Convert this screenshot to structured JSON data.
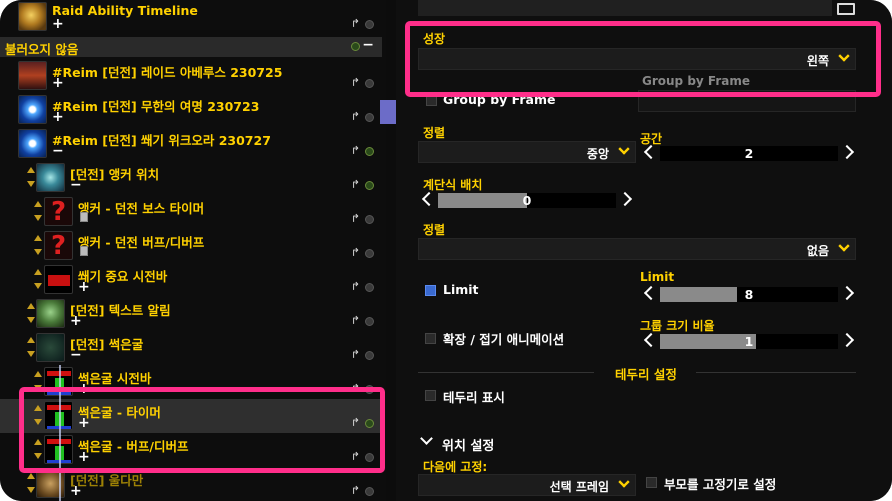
{
  "left_panel": {
    "rows": [
      {
        "title": "Raid Ability Timeline",
        "icon": "raid-icon"
      },
      {
        "title": "#Reim [던전] 레이드 아베루스 230725",
        "icon": "boss-icon"
      },
      {
        "title": "#Reim [던전] 무한의 여명 230723",
        "icon": "blue-rune-icon"
      },
      {
        "title": "#Reim [던전] 쐐기 위크오라 230727",
        "icon": "blue-rune-icon"
      },
      {
        "title": "[던전] 앵커 위치",
        "icon": "anchor-icon"
      },
      {
        "title": "앵커 - 던전 보스 타이머",
        "icon": "question-mark-icon"
      },
      {
        "title": "앵커 - 던전 버프/디버프",
        "icon": "question-mark-icon"
      },
      {
        "title": "쐐기 중요 시전바",
        "icon": "red-bar-icon"
      },
      {
        "title": "[던전] 텍스트 알림",
        "icon": "face-icon"
      },
      {
        "title": "[던전] 썩은굴",
        "icon": "corrupt-icon"
      },
      {
        "title": "썩은굴 시전바",
        "icon": "bars-icon"
      },
      {
        "title": "썩은굴 - 타이머",
        "icon": "bars-icon"
      },
      {
        "title": "썩은굴 - 버프/디버프",
        "icon": "bars-icon"
      },
      {
        "title": "[던전] 울다만",
        "icon": "gold-icon"
      }
    ],
    "not_loaded_header": "불러오지 않음",
    "plus": "+",
    "minus": "−",
    "share_glyph": "↱",
    "question_glyph": "?"
  },
  "right_panel": {
    "grow_label": "성장",
    "grow_value": "왼쪽",
    "group_by_frame_hint": "Group by Frame",
    "group_by_frame_checkbox": "Group by Frame",
    "align_label": "정렬",
    "align_value": "중앙",
    "space_label": "공간",
    "space_value": "2",
    "stagger_label": "계단식 배치",
    "stagger_value": "0",
    "sort_label": "정렬",
    "sort_value": "없음",
    "limit_checkbox": "Limit",
    "limit_label": "Limit",
    "limit_value": "8",
    "animate_label": "확장 / 접기 애니메이션",
    "scale_label": "그룹 크기 비율",
    "scale_value": "1",
    "border_section": "테두리 설정",
    "show_border_label": "테두리 표시",
    "position_section": "위치 설정",
    "anchor_to_label": "다음에 고정:",
    "anchor_to_value": "선택 프레임",
    "parent_anchor_label": "부모를 고정기로 설정",
    "limit_checked": true,
    "limit_slider_fraction": 0.43,
    "space_slider_fraction": 0.0,
    "stagger_slider_fraction": 0.5,
    "scale_slider_fraction": 0.54
  },
  "colors": {
    "accent_gold": "#ffd100",
    "highlight_pink": "#ff2e8a",
    "checkbox_blue": "#3a6ad0"
  }
}
